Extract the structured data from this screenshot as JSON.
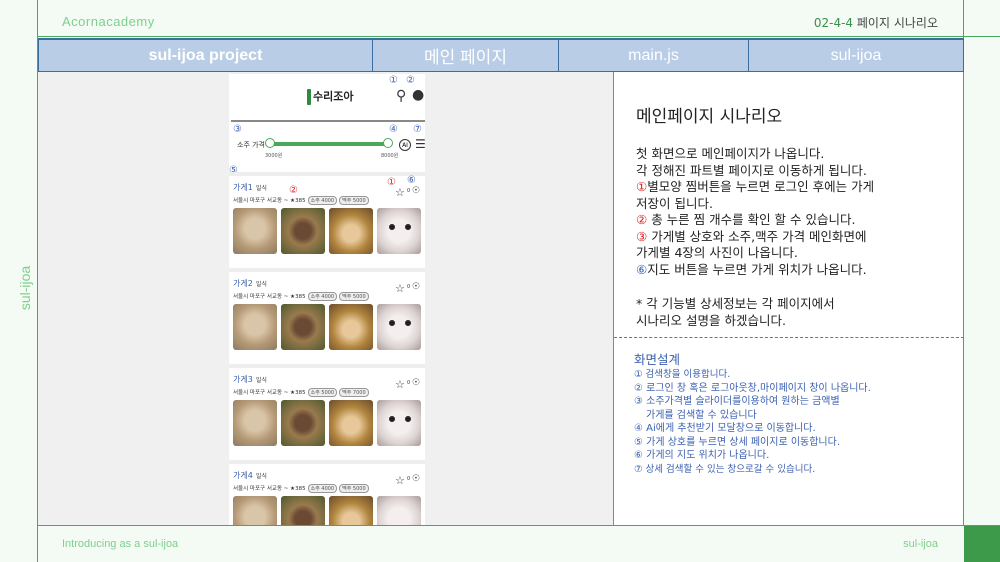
{
  "top": {
    "left_label": "Acornacademy",
    "right_num": "02-4-4",
    "right_label": "페이지 시나리오"
  },
  "side_label": "sul-ijoa",
  "header": {
    "project": "sul-ijoa project",
    "page": "메인 페이지",
    "file": "main.js",
    "app": "sul-ijoa"
  },
  "footer": {
    "left": "Introducing as a sul-ijoa",
    "right": "sul-ijoa"
  },
  "mock": {
    "logo": "수리조아",
    "search_icon": "search-icon",
    "user_icon": "user-icon",
    "price_label": "소주 가격",
    "price_min": "3000원",
    "price_max": "8000원",
    "ai_label": "AI",
    "cards": [
      {
        "title": "가게1",
        "sub": "일식",
        "addr": "서울시 마포구 서교동 ~",
        "rating": "★385",
        "soju": "소주 4000",
        "beer": "맥주 5000",
        "count": "0"
      },
      {
        "title": "가게2",
        "sub": "일식",
        "addr": "서울시 마포구 서교동 ~",
        "rating": "★385",
        "soju": "소주 4000",
        "beer": "맥주 5000",
        "count": "0"
      },
      {
        "title": "가게3",
        "sub": "일식",
        "addr": "서울시 마포구 서교동 ~",
        "rating": "★385",
        "soju": "소주 5000",
        "beer": "맥주 7000",
        "count": "0"
      },
      {
        "title": "가게4",
        "sub": "일식",
        "addr": "서울시 마포구 서교동 ~",
        "rating": "★385",
        "soju": "소주 4000",
        "beer": "맥주 5000",
        "count": "0"
      }
    ],
    "markers": {
      "m1": "①",
      "m2": "②",
      "m3": "③",
      "m4": "④",
      "m5": "⑤",
      "m6": "⑥",
      "m7": "⑦"
    }
  },
  "scenario": {
    "title": "메인페이지 시나리오",
    "line1": "첫 화면으로 메인페이지가 나옵니다.",
    "line2": "각 정해진 파트별 페이지로 이동하게 됩니다.",
    "m1": "①",
    "line3": "별모양 찜버튼을 누르면 로그인 후에는 가게",
    "line3b": "저장이 됩니다.",
    "m2": "②",
    "line4": " 총 누른 찜 개수를 확인 할 수 있습니다.",
    "m3": "③",
    "line5": " 가게별 상호와 소주,맥주 가격 메인화면에",
    "line5b": "가게별 4장의 사진이 나옵니다.",
    "m6": "⑥",
    "line6": "지도 버튼을 누르면 가게 위치가 나옵니다.",
    "note1": "* 각 기능별 상세정보는 각 페이지에서",
    "note2": "시나리오 설명을 하겠습니다."
  },
  "design": {
    "title": "화면설계",
    "items": [
      "① 검색창을 이용합니다.",
      "② 로그인 창 혹은 로그아웃창,마이페이지 창이 나옵니다.",
      "③ 소주가격별 슬라이더를이용하여 원하는 금액별",
      "가게를 검색할 수 있습니다",
      "④ Ai에게 추천받기 모달창으로 이동합니다.",
      "⑤ 가게 상호를 누르면 상세 페이지로 이동합니다.",
      "⑥ 가게의 지도 위치가 나옵니다.",
      "⑦ 상세 검색할 수 있는 창으로갈 수 있습니다."
    ]
  }
}
